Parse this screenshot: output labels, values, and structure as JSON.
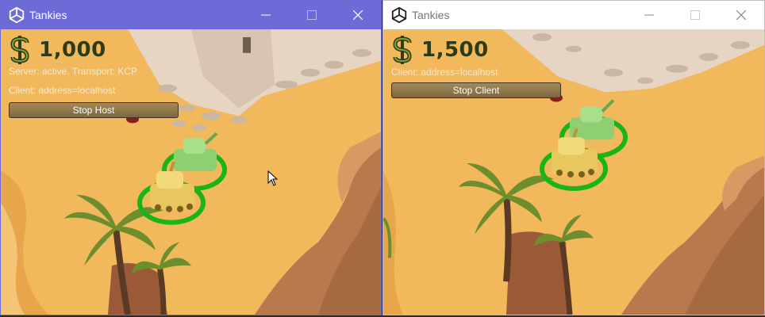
{
  "windows": {
    "left": {
      "title": "Tankies",
      "money": "1,000",
      "server_status": "Server: active. Transport: KCP",
      "client_status": "Client: address=localhost",
      "button_label": "Stop Host"
    },
    "right": {
      "title": "Tankies",
      "money": "1,500",
      "client_status": "Client: address=localhost",
      "button_label": "Stop Client"
    }
  },
  "colors": {
    "sand": "#f1b85c",
    "left_titlebar": "#6e6bd8",
    "selection_ring": "#18b418",
    "money_text": "#2f3b16"
  },
  "icons": [
    "unity-logo-icon",
    "minimize-icon",
    "maximize-icon",
    "close-icon",
    "dollar-icon",
    "mouse-cursor-icon"
  ]
}
